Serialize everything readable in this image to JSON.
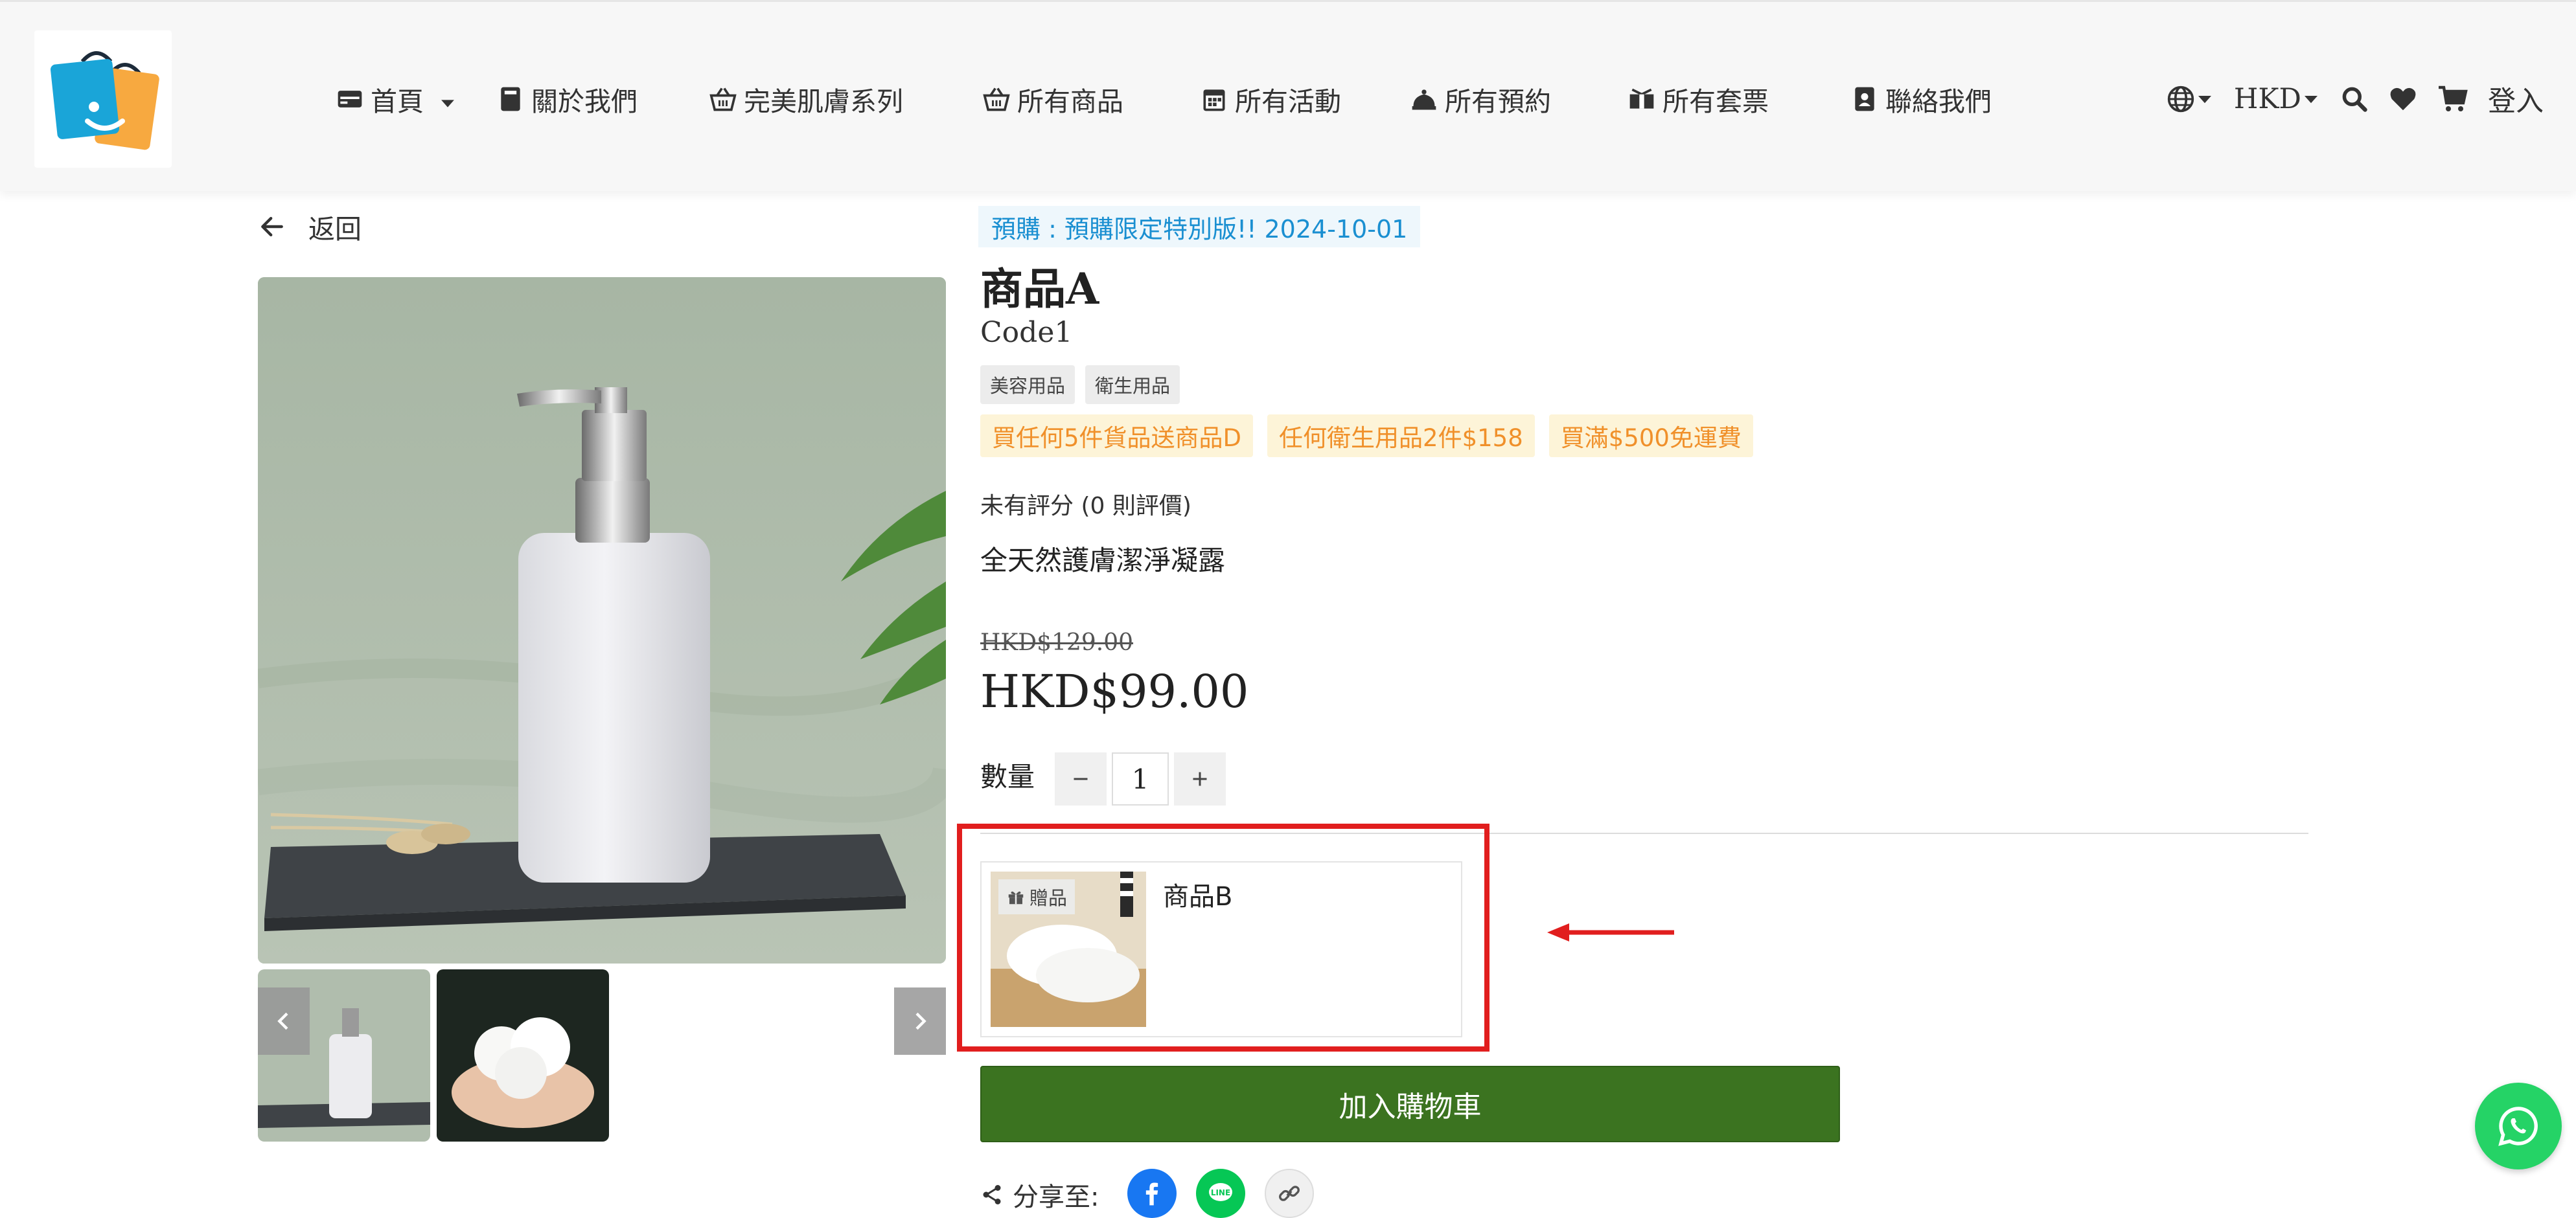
{
  "header": {
    "nav": [
      {
        "label": "首頁",
        "icon": "home-card-icon",
        "has_dropdown": true
      },
      {
        "label": "關於我們",
        "icon": "book-icon"
      },
      {
        "label": "完美肌膚系列",
        "icon": "basket-icon"
      },
      {
        "label": "所有商品",
        "icon": "basket-icon"
      },
      {
        "label": "所有活動",
        "icon": "calendar-icon"
      },
      {
        "label": "所有預約",
        "icon": "bell-icon"
      },
      {
        "label": "所有套票",
        "icon": "ticket-icon"
      },
      {
        "label": "聯絡我們",
        "icon": "contact-book-icon"
      }
    ],
    "currency": "HKD",
    "login": "登入"
  },
  "back_label": "返回",
  "product": {
    "preorder": "預購 : 預購限定特別版!! 2024-10-01",
    "name": "商品A",
    "code": "Code1",
    "tags": [
      "美容用品",
      "衛生用品"
    ],
    "promotions": [
      "買任何5件貨品送商品D",
      "任何衛生用品2件$158",
      "買滿$500免運費"
    ],
    "rating": "未有評分 (0 則評價)",
    "description": "全天然護膚潔淨凝露",
    "original_price": "HKD$129.00",
    "price": "HKD$99.00",
    "quantity_label": "數量",
    "quantity": "1"
  },
  "gift": {
    "badge": "贈品",
    "name": "商品B"
  },
  "add_to_cart": "加入購物車",
  "share_label": "分享至:",
  "colors": {
    "accent_green": "#3b7320",
    "preorder_blue": "#1a8fd1",
    "promo_orange": "#f0902a",
    "highlight_red": "#e11e1e",
    "whatsapp_green": "#25d366"
  }
}
